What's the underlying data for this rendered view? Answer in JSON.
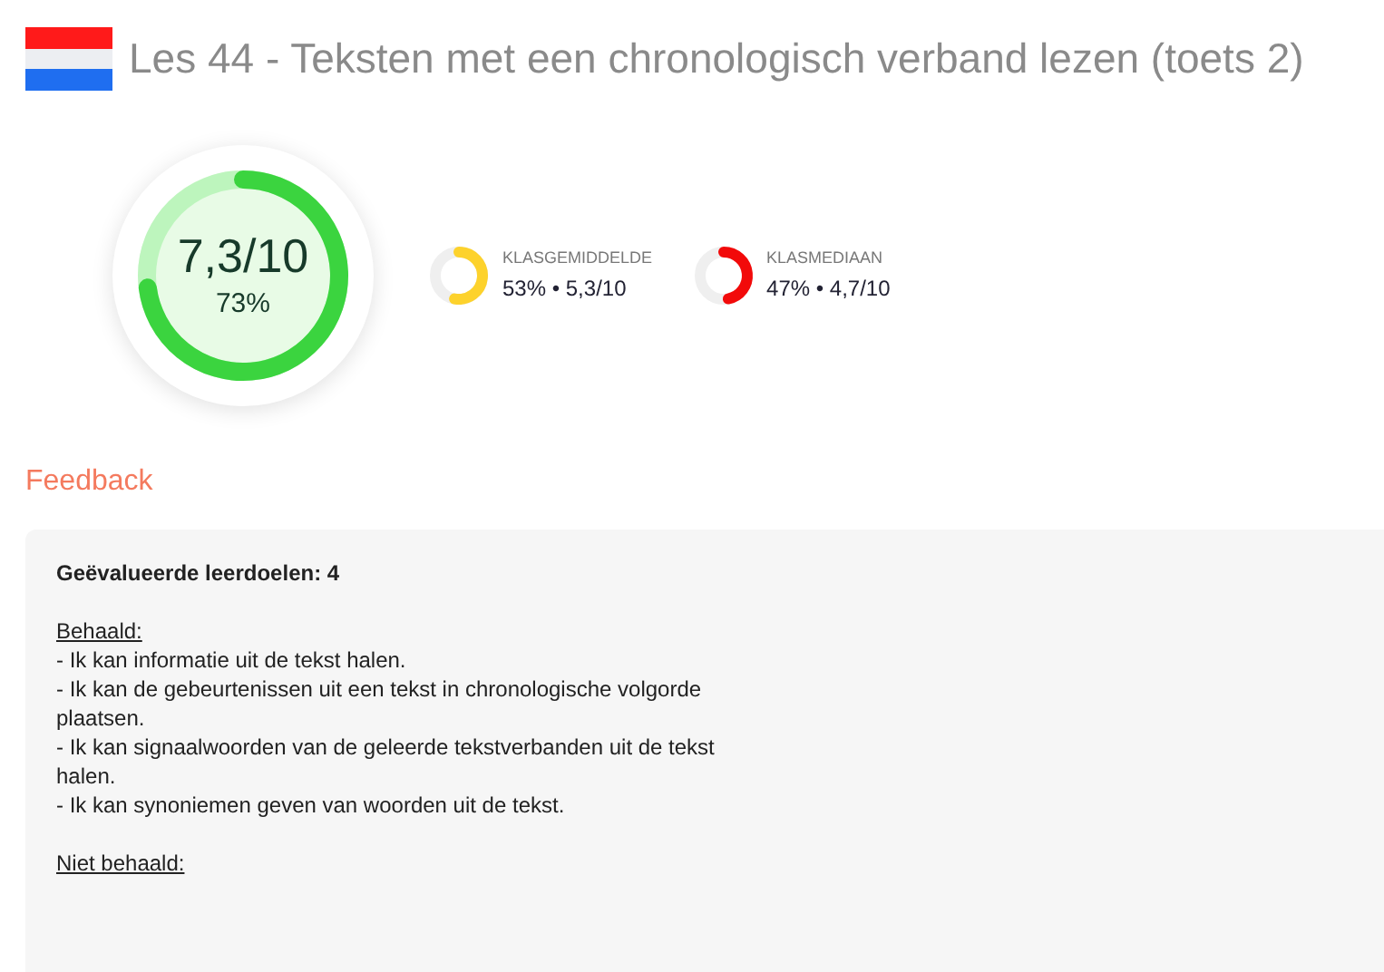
{
  "title": "Les 44 - Teksten met een chronologisch verband lezen (toets 2)",
  "score": {
    "grade": "7,3/10",
    "percent": "73%"
  },
  "stats": [
    {
      "label": "KLASGEMIDDELDE",
      "value": "53% • 5,3/10",
      "color": "#fdd22c"
    },
    {
      "label": "KLASMEDIAAN",
      "value": "47% • 4,7/10",
      "color": "#f20a0a"
    }
  ],
  "feedback_title": "Feedback",
  "feedback": {
    "heading": "Geëvalueerde leerdoelen: 4",
    "sections": [
      {
        "title": "Behaald:",
        "items": [
          "- Ik kan informatie uit de tekst halen.",
          "- Ik kan de gebeurtenissen uit een tekst in chronologische volgorde plaatsen.",
          "- Ik kan signaalwoorden van de geleerde tekstverbanden uit de tekst halen.",
          "- Ik kan synoniemen geven van woorden uit de tekst."
        ]
      },
      {
        "title": "Niet behaald:"
      }
    ]
  }
}
